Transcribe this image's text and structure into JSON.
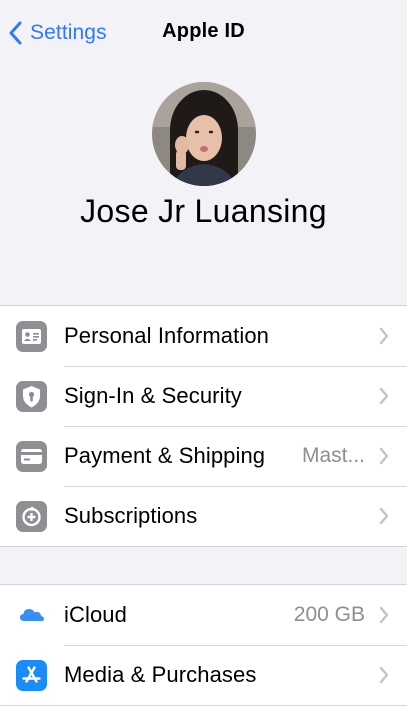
{
  "nav": {
    "back_label": "Settings",
    "title": "Apple ID"
  },
  "profile": {
    "name": "Jose Jr Luansing"
  },
  "groups": [
    {
      "rows": [
        {
          "label": "Personal Information",
          "icon": "person-card-icon",
          "value": ""
        },
        {
          "label": "Sign-In & Security",
          "icon": "shield-keyhole-icon",
          "value": ""
        },
        {
          "label": "Payment & Shipping",
          "icon": "credit-card-icon",
          "value": "Mast..."
        },
        {
          "label": "Subscriptions",
          "icon": "subscriptions-icon",
          "value": ""
        }
      ]
    },
    {
      "rows": [
        {
          "label": "iCloud",
          "icon": "icloud-icon",
          "value": "200 GB"
        },
        {
          "label": "Media & Purchases",
          "icon": "app-store-icon",
          "value": ""
        }
      ]
    }
  ],
  "colors": {
    "accent": "#2f7bf5",
    "background": "#f2f2f7",
    "icon_gray": "#8e8e93",
    "icloud_blue": "#3a8ef0",
    "app_store_blue": "#1a8cf7"
  }
}
